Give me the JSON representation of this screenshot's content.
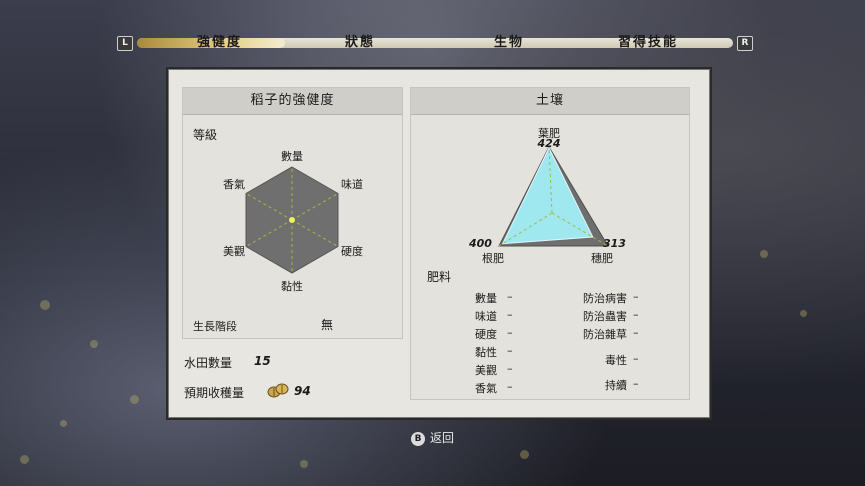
{
  "tabs": {
    "left_bumper": "L",
    "right_bumper": "R",
    "items": [
      "強健度",
      "狀態",
      "生物",
      "習得技能"
    ],
    "active_index": 0
  },
  "left_card": {
    "title": "稻子的強健度",
    "grade_label": "等級",
    "axes": {
      "top": "數量",
      "top_right": "味道",
      "bottom_right": "硬度",
      "bottom": "黏性",
      "bottom_left": "美觀",
      "top_left": "香氣"
    },
    "growth_label": "生長階段",
    "growth_value": "無"
  },
  "field_count_label": "水田數量",
  "field_count_value": "15",
  "expected_yield_label": "預期收穫量",
  "expected_yield_value": "94",
  "yield_icon": "rice-bale-icon",
  "right_card": {
    "title": "土壤",
    "leaf_label": "葉肥",
    "leaf_value": "424",
    "root_label": "根肥",
    "root_value": "400",
    "ear_label": "穗肥",
    "ear_value": "313",
    "fertilizer_label": "肥料",
    "stats_left": [
      {
        "label": "數量",
        "value": "–"
      },
      {
        "label": "味道",
        "value": "–"
      },
      {
        "label": "硬度",
        "value": "–"
      },
      {
        "label": "黏性",
        "value": "–"
      },
      {
        "label": "美觀",
        "value": "–"
      },
      {
        "label": "香氣",
        "value": "–"
      }
    ],
    "stats_right": [
      {
        "label": "防治病害",
        "value": "–"
      },
      {
        "label": "防治蟲害",
        "value": "–"
      },
      {
        "label": "防治雜草",
        "value": "–"
      },
      {
        "label": "毒性",
        "value": "–"
      },
      {
        "label": "持續",
        "value": "–"
      }
    ]
  },
  "soil_chart": {
    "leaf": 424,
    "root": 400,
    "ear": 313,
    "fill_color": "#9fe8f0"
  },
  "back_button": {
    "glyph": "B",
    "label": "返回"
  },
  "accent_color": "#e6cf86"
}
